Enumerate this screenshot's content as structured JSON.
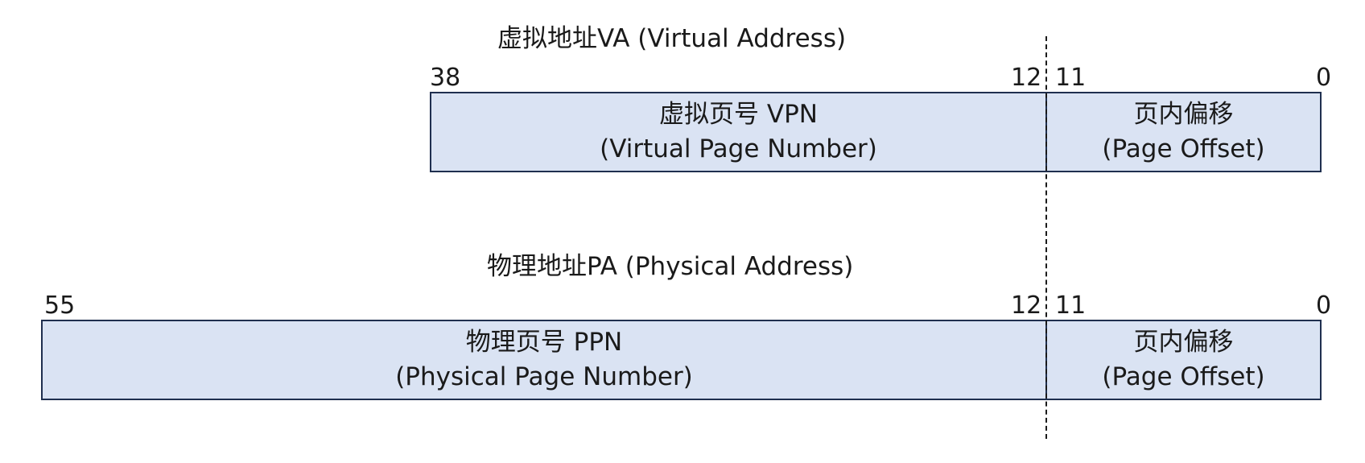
{
  "va": {
    "title": "虚拟地址VA (Virtual Address)",
    "bit_high": "38",
    "bit_12": "12",
    "bit_11": "11",
    "bit_0": "0",
    "page_number": {
      "line1": "虚拟页号 VPN",
      "line2": "(Virtual Page Number)"
    },
    "page_offset": {
      "line1": "页内偏移",
      "line2": "(Page Offset)"
    }
  },
  "pa": {
    "title": "物理地址PA (Physical Address)",
    "bit_high": "55",
    "bit_12": "12",
    "bit_11": "11",
    "bit_0": "0",
    "page_number": {
      "line1": "物理页号 PPN",
      "line2": "(Physical Page Number)"
    },
    "page_offset": {
      "line1": "页内偏移",
      "line2": "(Page Offset)"
    }
  },
  "colors": {
    "field_fill": "#dae3f3",
    "field_border": "#1f2f4f"
  }
}
